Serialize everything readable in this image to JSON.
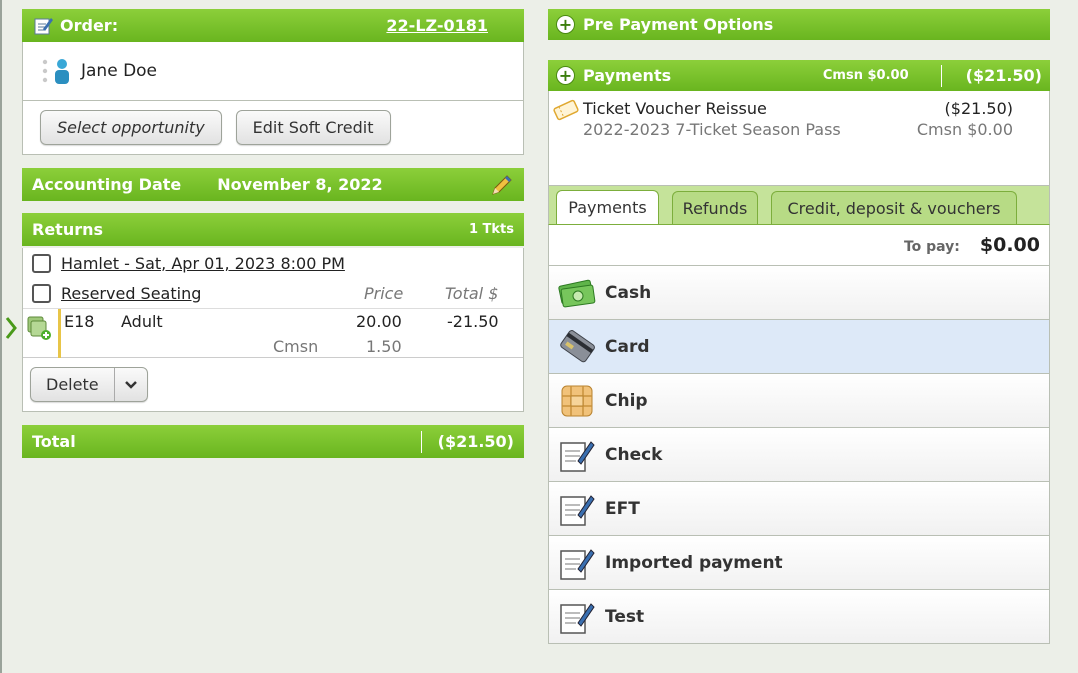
{
  "order": {
    "label": "Order:",
    "number": "22-LZ-0181",
    "customer_name": "Jane Doe"
  },
  "buttons": {
    "select_opportunity": "Select opportunity",
    "edit_soft_credit": "Edit Soft Credit"
  },
  "accounting": {
    "label": "Accounting Date",
    "date": "November 8, 2022"
  },
  "returns": {
    "label": "Returns",
    "tickets": "1 Tkts",
    "event": "Hamlet - Sat, Apr 01, 2023 8:00 PM",
    "section": "Reserved Seating",
    "col_price": "Price",
    "col_total": "Total $",
    "seat": "E18",
    "type": "Adult",
    "price": "20.00",
    "total": "-21.50",
    "cmsn_label": "Cmsn",
    "cmsn": "1.50",
    "delete_label": "Delete"
  },
  "total": {
    "label": "Total",
    "amount": "($21.50)"
  },
  "pre_payment": {
    "label": "Pre Payment Options"
  },
  "payments": {
    "label": "Payments",
    "cmsn": "Cmsn $0.00",
    "amount": "($21.50)",
    "item": {
      "name": "Ticket Voucher Reissue",
      "desc": "2022-2023 7-Ticket Season Pass",
      "amount": "($21.50)",
      "cmsn": "Cmsn $0.00"
    }
  },
  "tabs": [
    "Payments",
    "Refunds",
    "Credit, deposit & vouchers"
  ],
  "to_pay": {
    "label": "To pay:",
    "amount": "$0.00"
  },
  "methods": [
    {
      "label": "Cash",
      "icon": "cash-icon"
    },
    {
      "label": "Card",
      "icon": "card-icon"
    },
    {
      "label": "Chip",
      "icon": "chip-icon"
    },
    {
      "label": "Check",
      "icon": "check-icon"
    },
    {
      "label": "EFT",
      "icon": "eft-icon"
    },
    {
      "label": "Imported payment",
      "icon": "imported-payment-icon"
    },
    {
      "label": "Test",
      "icon": "test-icon"
    }
  ],
  "colors": {
    "green_bar": "#78c02a",
    "selected_row": "#dde9f8",
    "tab_strip": "#c5e39a"
  }
}
